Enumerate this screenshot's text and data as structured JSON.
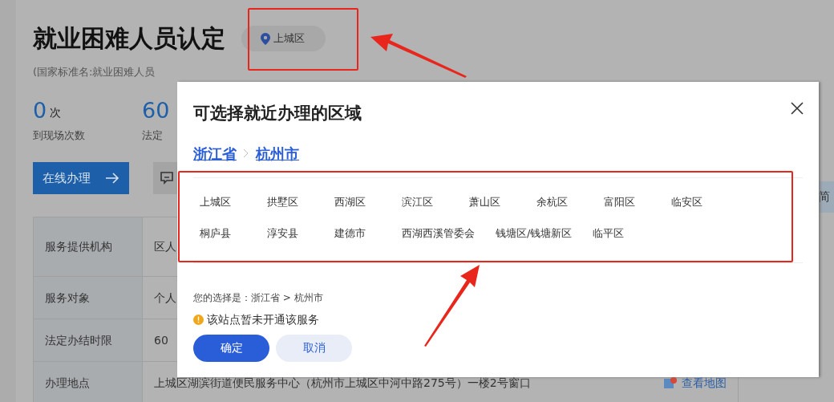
{
  "page": {
    "title": "就业困难人员认定",
    "location": "上城区",
    "subtitle": "(国家标准名:就业困难人员",
    "stats": [
      {
        "value": "0",
        "unit": "次",
        "label": "到现场次数"
      },
      {
        "value": "60",
        "label": "法定"
      }
    ],
    "online_button": "在线办理",
    "side_tab": "简",
    "table": [
      {
        "label": "服务提供机构",
        "value": "区人"
      },
      {
        "label": "服务对象",
        "value": "个人"
      },
      {
        "label": "法定办结时限",
        "value": "60"
      },
      {
        "label": "办理地点",
        "value": "上城区湖滨街道便民服务中心（杭州市上城区中河中路275号）一楼2号窗口",
        "link": "查看地图"
      }
    ]
  },
  "dialog": {
    "title": "可选择就近办理的区域",
    "breadcrumb": [
      "浙江省",
      "杭州市"
    ],
    "districts": [
      "上城区",
      "拱墅区",
      "西湖区",
      "滨江区",
      "萧山区",
      "余杭区",
      "富阳区",
      "临安区",
      "桐庐县",
      "淳安县",
      "建德市",
      "西湖西溪管委会",
      "钱塘区/钱塘新区",
      "临平区"
    ],
    "selection_label": "您的选择是：浙江省 > 杭州市",
    "notice": {
      "kind": "warning",
      "text": "该站点暂未开通该服务"
    },
    "buttons": [
      {
        "label": "确定",
        "kind": "primary"
      },
      {
        "label": "取消",
        "kind": "secondary"
      }
    ]
  }
}
